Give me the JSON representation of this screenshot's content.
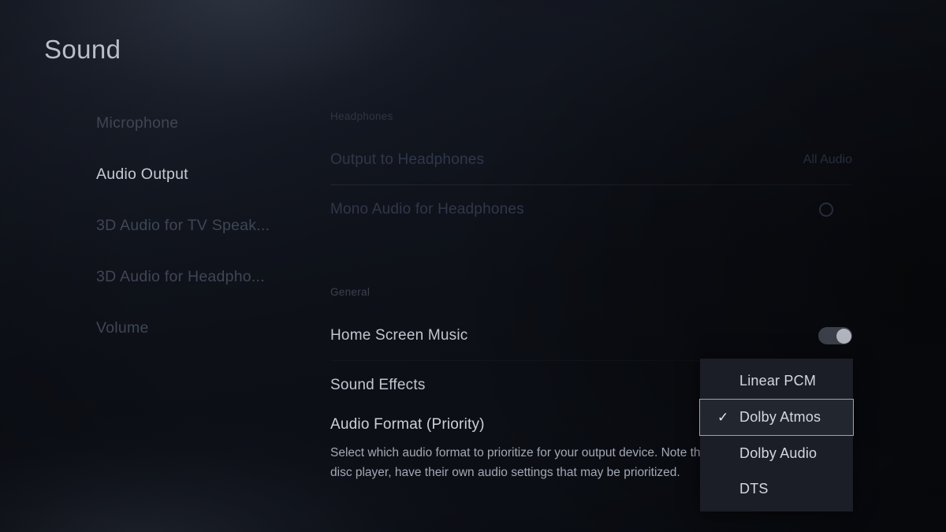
{
  "page": {
    "title": "Sound"
  },
  "sidebar": {
    "items": [
      {
        "label": "Microphone",
        "active": false
      },
      {
        "label": "Audio Output",
        "active": true
      },
      {
        "label": "3D Audio for TV Speak...",
        "active": false
      },
      {
        "label": "3D Audio for Headpho...",
        "active": false
      },
      {
        "label": "Volume",
        "active": false
      }
    ]
  },
  "sections": {
    "headphones": {
      "heading": "Headphones",
      "output_to_headphones": {
        "label": "Output to Headphones",
        "value": "All Audio"
      },
      "mono_audio": {
        "label": "Mono Audio for Headphones",
        "toggle_state": "off"
      }
    },
    "general": {
      "heading": "General",
      "home_screen_music": {
        "label": "Home Screen Music",
        "toggle_state": "on"
      },
      "sound_effects": {
        "label": "Sound Effects"
      },
      "audio_format": {
        "label": "Audio Format (Priority)",
        "description_line1": "Select which audio format to prioritize for your output device. Note th",
        "description_line2": "disc player, have their own audio settings that may be prioritized."
      }
    }
  },
  "dropdown": {
    "options": [
      {
        "label": "Linear PCM",
        "selected": false
      },
      {
        "label": "Dolby Atmos",
        "selected": true
      },
      {
        "label": "Dolby Audio",
        "selected": false
      },
      {
        "label": "DTS",
        "selected": false
      }
    ],
    "check_glyph": "✓",
    "selected_value": "Dolby Atmos"
  },
  "colors": {
    "background": "#0c0f16",
    "text_primary": "#c2c6d0",
    "text_dim": "#3f4654",
    "dropdown_bg": "#1b1e26",
    "selection_border": "#9ca3b0",
    "toggle_knob": "#b0b4bd"
  }
}
